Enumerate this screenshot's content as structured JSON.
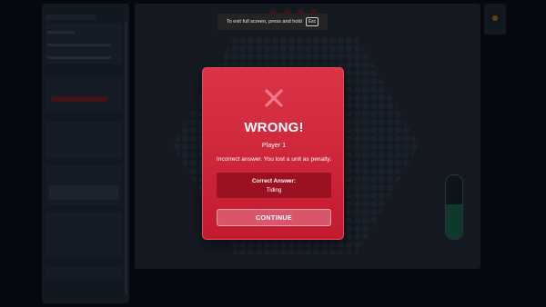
{
  "fullscreen_hint": {
    "text": "To exit full screen, press and hold",
    "key": "Esc"
  },
  "modal": {
    "title": "WRONG!",
    "player": "Player 1",
    "message": "Incorrect answer. You lost a unit as penalty.",
    "correct_answer_label": "Correct Answer:",
    "correct_answer_value": "Tiding",
    "continue_label": "CONTINUE",
    "icon": "close-x-icon"
  },
  "background": {
    "gauge_level_fraction": 0.55
  },
  "colors": {
    "modal_accent": "#dc3447",
    "x_icon": "#f27a8a",
    "answer_box": "#9b1122",
    "continue_button": "#d9566a"
  }
}
